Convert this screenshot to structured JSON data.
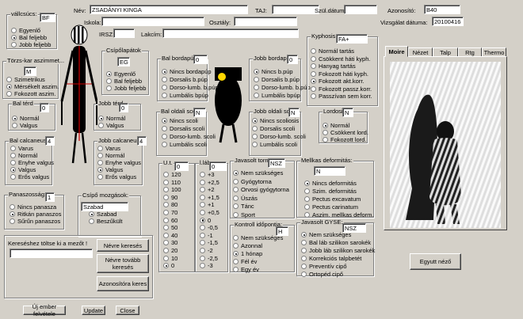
{
  "header": {
    "name_label": "Név:",
    "name_value": "ZSADÁNYI KINGA",
    "taj_label": "TAJ:",
    "taj_value": "",
    "dob_label": "Szül.dátum:",
    "dob_value": "",
    "id_label": "Azonosító:",
    "id_value": "B40",
    "school_label": "Iskola:",
    "school_value": "",
    "class_label": "Osztály:",
    "class_value": "",
    "exam_date_label": "Vizsgálat dátuma:",
    "exam_date_value": "20100416",
    "irsz_label": "IRSZ:",
    "irsz_value": "",
    "address_label": "Lakcím:",
    "address_value": ""
  },
  "shoulder": {
    "title": "vállcsúcs:",
    "value": "BF",
    "options": [
      "Egyenlő",
      "Bal feljebb",
      "Jobb feljebb"
    ],
    "selected": 1
  },
  "torso": {
    "title": "Törzs-kar aszimmet...",
    "value": "M",
    "options": [
      "Szimetrikus",
      "Mérsékelt aszim.",
      "Fokozott aszim."
    ],
    "selected": 1
  },
  "hip": {
    "title": "Csípőlapátok",
    "value": "EG",
    "options": [
      "Egyenlő",
      "Bal feljebb",
      "Jobb feljebb"
    ],
    "selected": 0
  },
  "left_knee": {
    "title": "Bal térd",
    "value": "0",
    "options": [
      "Normál",
      "Valgus"
    ],
    "selected": 0
  },
  "right_knee": {
    "title": "Jobb térd",
    "value": "0",
    "options": [
      "Normál",
      "Valgus"
    ],
    "selected": 0
  },
  "left_calc": {
    "title": "Bal calcaneus:",
    "value": "4",
    "options": [
      "Varus",
      "Normál",
      "Enyhe valgus",
      "Valgus",
      "Erős valgus"
    ],
    "selected": 3
  },
  "right_calc": {
    "title": "Jobb calcaneus:",
    "value": "4",
    "options": [
      "Varus",
      "Normál",
      "Enyhe valgus",
      "Valgus",
      "Erős valgus"
    ],
    "selected": 3
  },
  "flat": {
    "title": "Panaszosság:",
    "value": "1",
    "options": [
      "Nincs panasza",
      "Ritkán panaszos",
      "Sűrűn panaszos"
    ],
    "selected": 1
  },
  "hip_move": {
    "title": "Csípő mozgások:",
    "value": "Szabad",
    "options": [
      "Szabad",
      "Beszűkült"
    ],
    "selected": 0
  },
  "left_bord": {
    "title": "Bal bordapúp:",
    "value": "0",
    "options": [
      "Nincs bordapúp",
      "Dorsalis b.púp",
      "Dorso-lumb. b.púp",
      "Lumbális bpúp"
    ],
    "selected": 0
  },
  "right_bord": {
    "title": "Jobb bordapúp:",
    "value": "0",
    "options": [
      "Nincs b.púp",
      "Dorsalis b.púp",
      "Dorso-lumb. b.púp",
      "Lumbális bpúp"
    ],
    "selected": 0
  },
  "left_scoli": {
    "title": "Bal oldali scoli:",
    "value": "N",
    "options": [
      "Nincs scoli",
      "Dorsalis scoli",
      "Dorso-lumb. scoli",
      "Lumbális scoli"
    ],
    "selected": 0
  },
  "right_scoli": {
    "title": "Jobb oldali scoli:",
    "value": "N",
    "options": [
      "Nincs scoliosis",
      "Dorsalis scoli",
      "Dorso-lumb. scoli",
      "Lumbális scoli"
    ],
    "selected": 0
  },
  "kyphosis": {
    "title": "Kyphosis:",
    "value": "FA+",
    "options": [
      "Normál tartás",
      "Csökkent háti kyph.",
      "Hanyag tartás",
      "Fokozott háti kyph.",
      "Fokozott akt.korr.",
      "Fokozott passz.korr.",
      "Passzívan sem korr."
    ],
    "selected": 4
  },
  "lordosis": {
    "title": "Lordosis:",
    "value": "N",
    "options": [
      "Normál",
      "Csökkent lord.",
      "Fokozott lord."
    ],
    "selected": 0
  },
  "ut": {
    "title": "U.t.",
    "value": "0",
    "options": [
      "120",
      "110",
      "100",
      "90",
      "80",
      "70",
      "60",
      "50",
      "40",
      "30",
      "20",
      "10",
      "0"
    ],
    "selected": 12
  },
  "lab": {
    "title": "l.láb",
    "value": "0",
    "options": [
      "+3",
      "+2,5",
      "+2",
      "+1,5",
      "+1",
      "+0,5",
      "0",
      "-0,5",
      "-1",
      "-1,5",
      "-2",
      "-2,5",
      "-3"
    ],
    "selected": 6
  },
  "pe": {
    "title": "Javasolt torna:",
    "value": "NSZ",
    "options": [
      "Nem szükséges",
      "Gyógytorna",
      "Orvosi gyógytorna",
      "Úszás",
      "Tánc",
      "Sport"
    ],
    "selected": 0
  },
  "chest": {
    "title": "Mellkas deformitás:",
    "value": "N",
    "options": [
      "Nincs deformitás",
      "Szim. deformitás",
      "Pectus excavatum",
      "Pectus carinatum",
      "Aszim. mellkas deform."
    ],
    "selected": 0
  },
  "control": {
    "title": "Kontroll időpontja:",
    "value": "H",
    "options": [
      "Nem szükséges",
      "Azonnal",
      "1 hónap",
      "Fél év",
      "Egy év"
    ],
    "selected": 2
  },
  "gyse": {
    "title": "Javasolt GYSE:",
    "value": "NSZ",
    "options": [
      "Nem szükséges",
      "Bal láb szilikon sarokék",
      "Jobb láb szilikon sarokék",
      "Korrekciós talpbetét",
      "Preventív cipő",
      "Ortopéd cipő"
    ],
    "selected": 0
  },
  "tabs": [
    "Moire",
    "Nézet",
    "Talp",
    "Rtg",
    "Thermo"
  ],
  "search": {
    "label": "Keresés­hez töltse ki a mezőt !",
    "value": "",
    "btn_name": "Névre keresés",
    "btn_name_next": "Névre tovább keresés",
    "btn_id": "Azonosítóra keres"
  },
  "actions": {
    "new": "Új ember felvétele",
    "update": "Update",
    "close": "Close",
    "single": "Egyutt néző"
  }
}
